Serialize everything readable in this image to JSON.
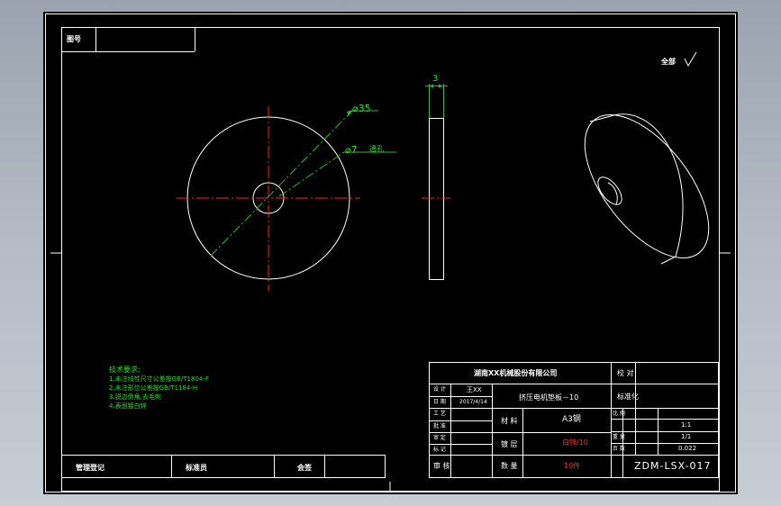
{
  "colors": {
    "background": "#000000",
    "line": "#ffffff",
    "center_line": "#ff2020",
    "dim_line": "#22c022",
    "text_red": "#ff2b2b",
    "text_green": "#1ee01e"
  },
  "drawing": {
    "view_front": {
      "outer_dim": "⌀35",
      "inner_dim": "⌀7",
      "inner_dim_note": "通孔"
    },
    "view_side": {
      "thickness_dim": "3"
    },
    "roughness": {
      "label": "全部",
      "symbol": "√"
    },
    "corner_label": "图号",
    "technical_requirements": {
      "title": "技术要求:",
      "items": [
        "1.未注线性尺寸公差按GB/T1804-F",
        "2.未注形位公差按GB/T1184-H",
        "3.锐边倒角,去毛刺",
        "4.表面镀白锌"
      ]
    }
  },
  "title_block": {
    "company": "湖南XX机械股份有限公司",
    "part_name": "挤压电机垫板－10",
    "designer_label": "设 计",
    "designer_name": "王XX",
    "date_label": "日 期",
    "date": "2017/4/14",
    "material_label": "材 料",
    "material": "A3钢",
    "process_label": "镀 层",
    "process": "白锌/10",
    "quantity_label": "数 量",
    "quantity": "10件",
    "drawing_no": "ZDM-LSX-017",
    "approve_label": "审 核",
    "check_label": "标准化",
    "side_labels": [
      "比 例",
      "重 量",
      "页 数"
    ],
    "side_values": [
      "1:1",
      "0.022",
      "1/1"
    ],
    "misc_labels": [
      "校 对",
      "工 艺",
      "批 准",
      "审 定",
      "标 记"
    ],
    "bottom_labels": [
      "管理登记",
      "标准员",
      "会签"
    ]
  }
}
